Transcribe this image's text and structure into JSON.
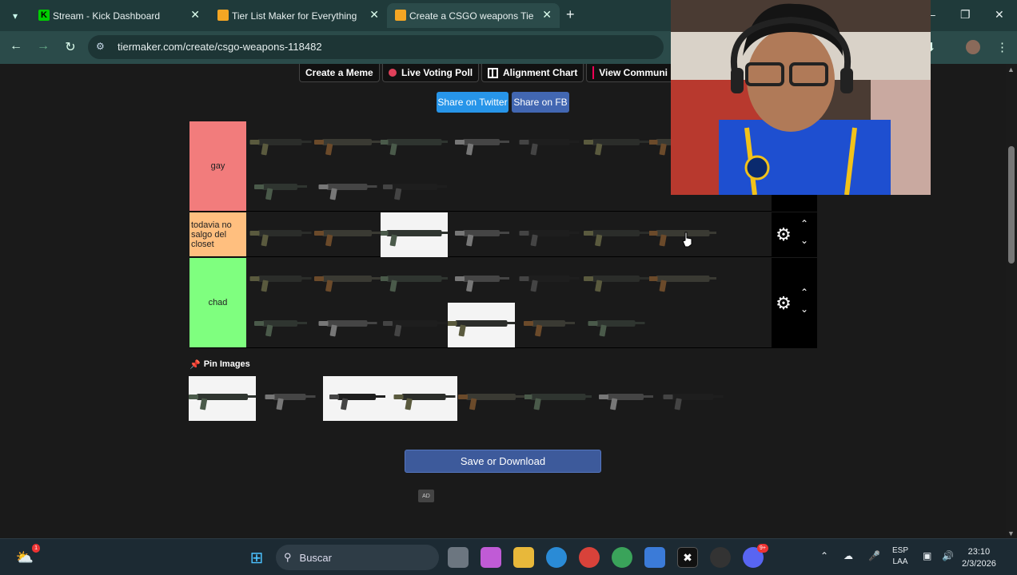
{
  "browser": {
    "tabs": [
      {
        "label": "Stream - Kick Dashboard",
        "icon": "kick-icon",
        "favicon_color": "#53fc18"
      },
      {
        "label": "Tier List Maker for Everything -",
        "icon": "tiermaker-icon",
        "favicon_color": "#f5a623"
      },
      {
        "label": "Create a CSGO weapons Tier Li",
        "icon": "tiermaker-icon",
        "favicon_color": "#f5a623",
        "active": true
      }
    ],
    "url": "tiermaker.com/create/csgo-weapons-118482",
    "new_tab_symbol": "+"
  },
  "toolbar": {
    "create_meme": "Create a Meme",
    "live_poll": "Live Voting Poll",
    "alignment_chart": "Alignment Chart",
    "view_community": "View Communi"
  },
  "share": {
    "twitter": "Share on Twitter",
    "twitter_color": "#2795e9",
    "fb": "Share on FB",
    "fb_color": "#4267b2"
  },
  "tiers": [
    {
      "label": "gay",
      "color": "#f27c7c",
      "items": 10
    },
    {
      "label": "todavia no salgo del closet",
      "color": "#ffbf7f",
      "items": 7
    },
    {
      "label": "chad",
      "color": "#7fff7f",
      "items": 13
    }
  ],
  "pin": {
    "label": "Pin Images"
  },
  "pool_items": 8,
  "save": {
    "label": "Save or Download",
    "color": "#3d5a9b"
  },
  "ad_label": "AD",
  "taskbar": {
    "search_placeholder": "Buscar",
    "language_top": "ESP",
    "language_bottom": "LAA",
    "time": "23:10",
    "date": "2/3/2026",
    "weather_badge": "1",
    "discord_badge": "9+"
  }
}
